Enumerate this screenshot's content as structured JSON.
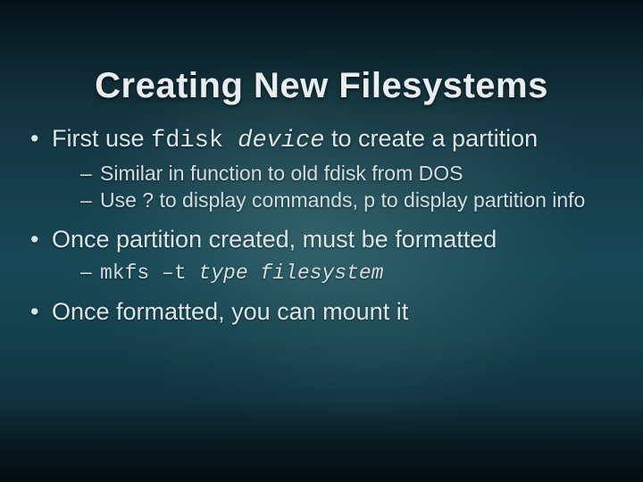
{
  "title": "Creating New Filesystems",
  "b1": {
    "pre": "First use ",
    "cmd": "fdisk ",
    "arg": "device",
    "post": " to create a partition",
    "sub1": "Similar in function to old fdisk from DOS",
    "sub2": "Use ? to display commands, p to display partition info"
  },
  "b2": {
    "text": "Once partition created, must be formatted",
    "sub1_cmd": "mkfs –t ",
    "sub1_arg": "type filesystem"
  },
  "b3": {
    "text": "Once formatted, you can mount it"
  }
}
